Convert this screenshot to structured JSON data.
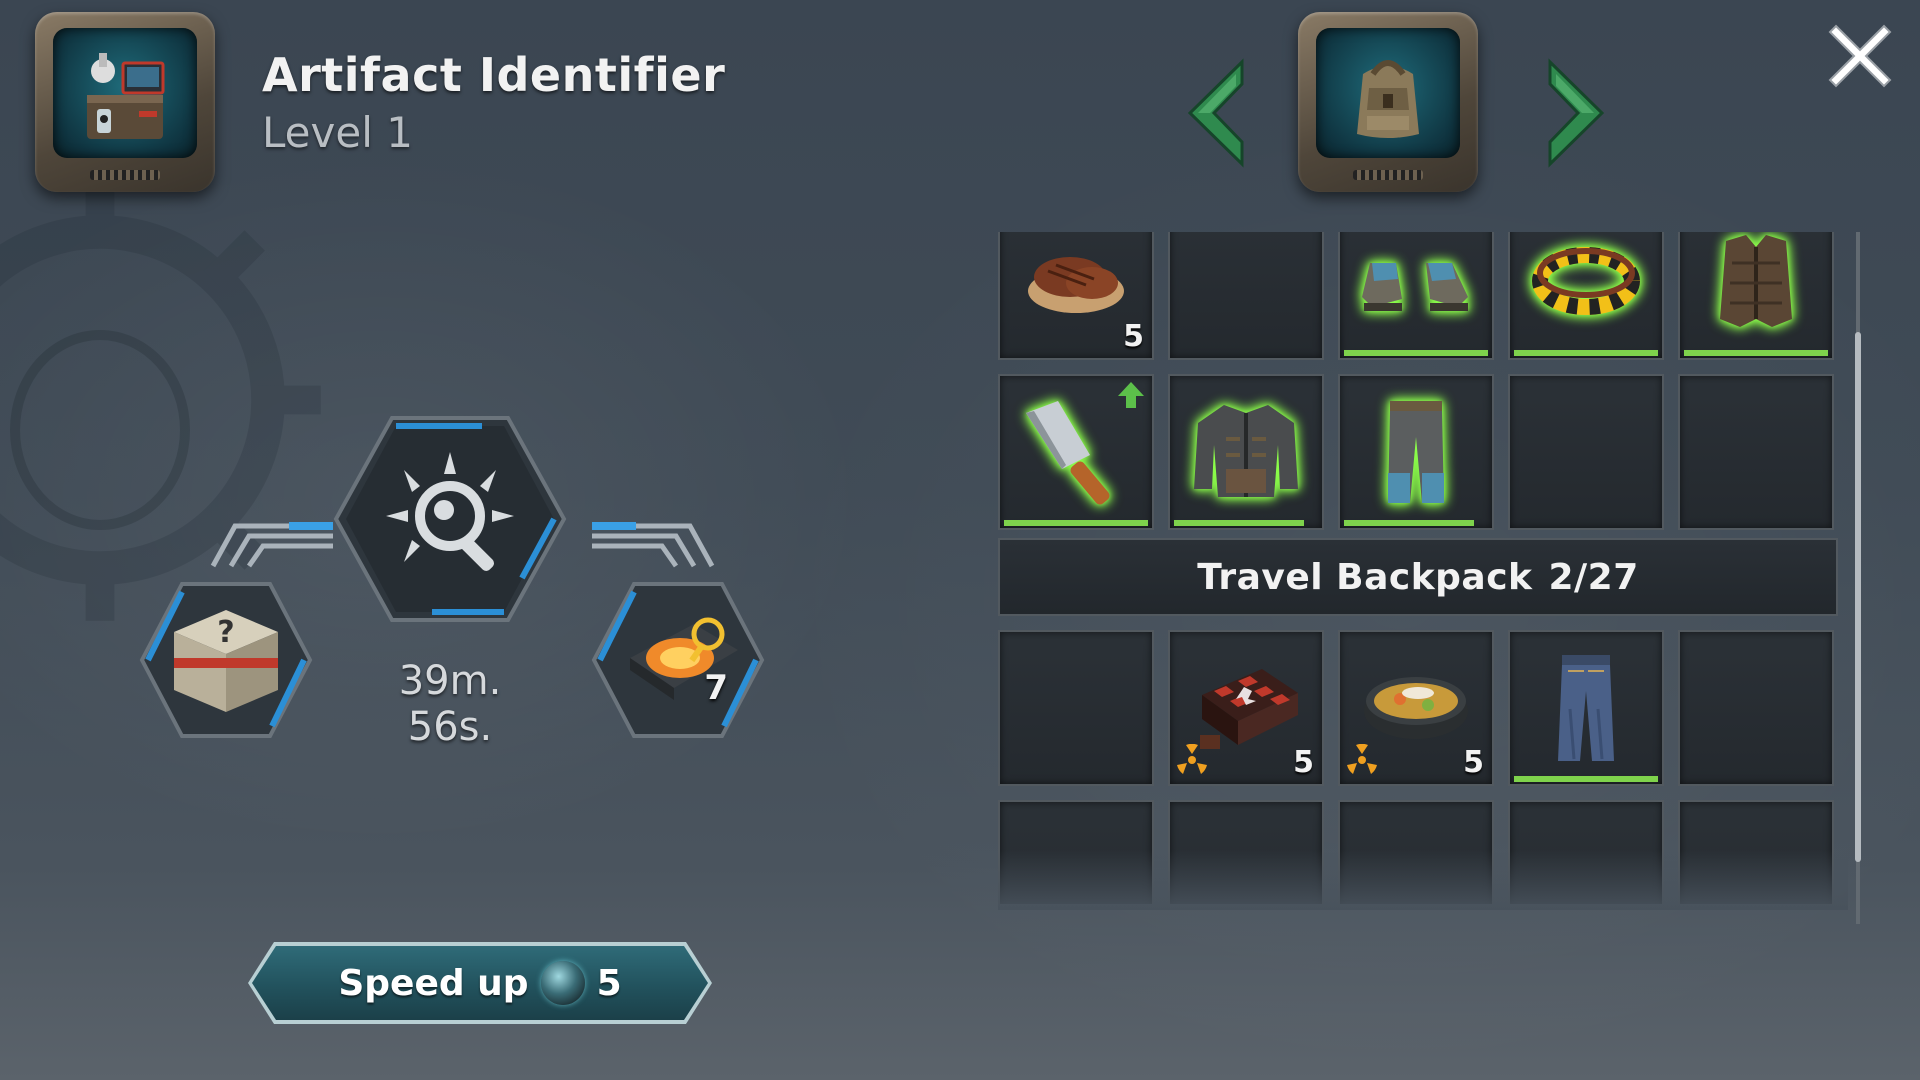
{
  "header": {
    "title": "Artifact Identifier",
    "level": "Level 1",
    "station_icon": "artifact-identifier-station-icon",
    "container_icon": "backpack-icon"
  },
  "identifier": {
    "timer": "39m. 56s.",
    "input_item_icon": "mystery-crate-icon",
    "output_item_icon": "hard-drive-icon",
    "output_count": "7",
    "speed_up": {
      "label": "Speed up",
      "cost": "5",
      "currency_icon": "energy-gem-icon"
    }
  },
  "inventory": {
    "row1": [
      {
        "icon": "steak-icon",
        "qty": "5"
      },
      {
        "icon": "empty"
      },
      {
        "icon": "boots-icon",
        "durability": 1.0
      },
      {
        "icon": "hazard-belt-icon",
        "durability": 1.0
      },
      {
        "icon": "leather-vest-icon",
        "durability": 1.0
      }
    ],
    "row2": [
      {
        "icon": "cleaver-icon",
        "durability": 1.0,
        "upgrade": true
      },
      {
        "icon": "jacket-icon",
        "durability": 0.9
      },
      {
        "icon": "pants-icon",
        "durability": 0.9
      },
      {
        "icon": "empty"
      },
      {
        "icon": "empty"
      }
    ],
    "backpack": {
      "name": "Travel Backpack",
      "capacity": "2/27"
    },
    "row3": [
      {
        "icon": "empty"
      },
      {
        "icon": "chocolate-box-icon",
        "qty": "5",
        "radiation": true
      },
      {
        "icon": "soup-pot-icon",
        "qty": "5",
        "radiation": true
      },
      {
        "icon": "jeans-icon",
        "durability": 1.0
      },
      {
        "icon": "empty"
      }
    ]
  },
  "colors": {
    "durability": "#7fd34c",
    "nav_arrow": "#2f8a4e",
    "accent_blue": "#2b8fd6",
    "radiation": "#f0a020"
  }
}
